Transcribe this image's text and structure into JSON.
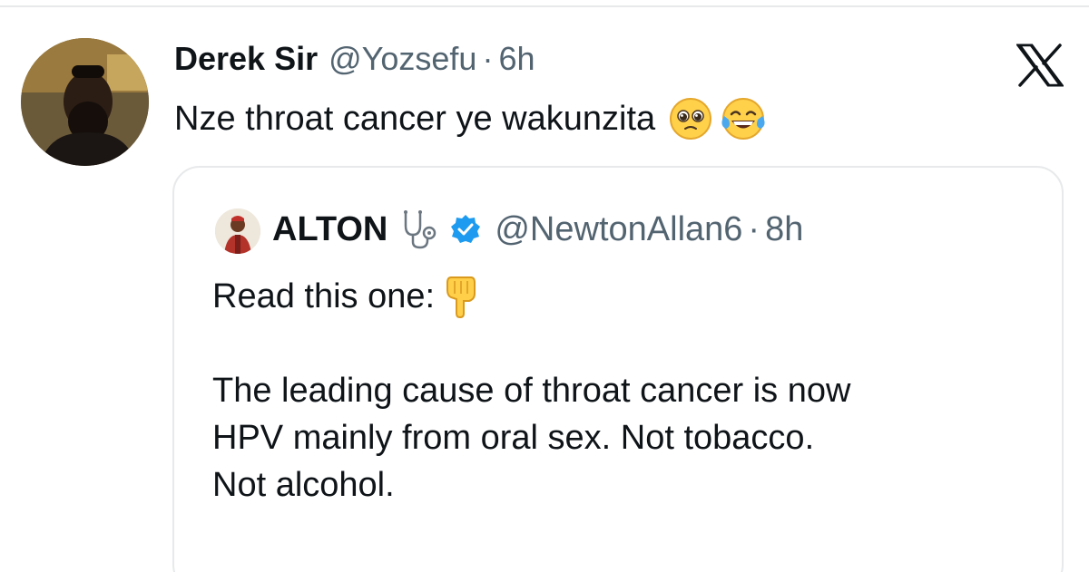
{
  "tweet": {
    "author_name": "Derek Sir",
    "author_handle": "@Yozsefu",
    "separator": "·",
    "time": "6h",
    "text": "Nze throat cancer ye wakunzita",
    "emojis": [
      "pleading-face-icon",
      "tears-of-joy-icon"
    ]
  },
  "brand": {
    "logo": "x-logo-icon"
  },
  "quoted_tweet": {
    "author_name": "ALTON",
    "author_handle": "@NewtonAllan6",
    "separator": "·",
    "time": "8h",
    "line1": "Read this one:",
    "line2": "The leading cause of throat cancer is now",
    "line3": "HPV mainly from oral sex. Not tobacco.",
    "line4": "Not alcohol."
  },
  "colors": {
    "text": "#0f1419",
    "secondary": "#536471",
    "border": "#e7e9ea",
    "verified": "#1d9bf0"
  }
}
